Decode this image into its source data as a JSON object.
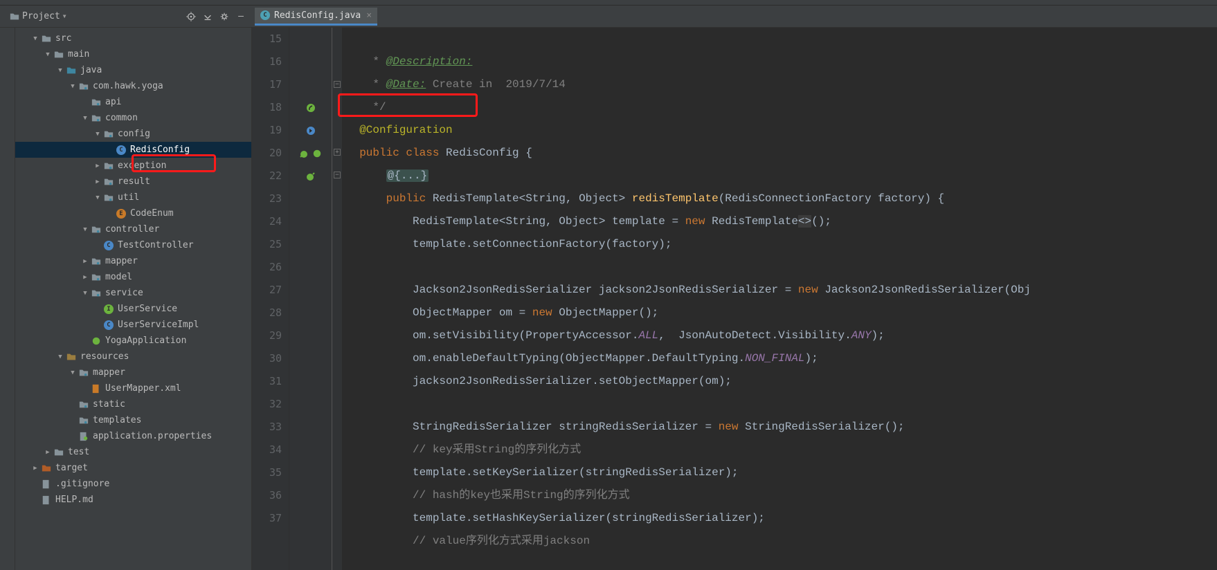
{
  "toolbar": {
    "project_label": "Project",
    "tab_name": "RedisConfig.java"
  },
  "tree": [
    {
      "depth": 0,
      "arrow": "open",
      "icon": "folder",
      "label": "src",
      "selectable": true
    },
    {
      "depth": 1,
      "arrow": "open",
      "icon": "folder",
      "label": "main",
      "selectable": true
    },
    {
      "depth": 2,
      "arrow": "open",
      "icon": "folder-src",
      "label": "java",
      "selectable": true
    },
    {
      "depth": 3,
      "arrow": "open",
      "icon": "package",
      "label": "com.hawk.yoga",
      "selectable": true
    },
    {
      "depth": 4,
      "arrow": "none",
      "icon": "package",
      "label": "api",
      "selectable": true
    },
    {
      "depth": 4,
      "arrow": "open",
      "icon": "package",
      "label": "common",
      "selectable": true
    },
    {
      "depth": 5,
      "arrow": "open",
      "icon": "package",
      "label": "config",
      "selectable": true
    },
    {
      "depth": 6,
      "arrow": "none",
      "icon": "class",
      "label": "RedisConfig",
      "selectable": true,
      "selected": true
    },
    {
      "depth": 5,
      "arrow": "closed",
      "icon": "package",
      "label": "exception",
      "selectable": true
    },
    {
      "depth": 5,
      "arrow": "closed",
      "icon": "package",
      "label": "result",
      "selectable": true
    },
    {
      "depth": 5,
      "arrow": "open",
      "icon": "package",
      "label": "util",
      "selectable": true
    },
    {
      "depth": 6,
      "arrow": "none",
      "icon": "enum",
      "label": "CodeEnum",
      "selectable": true
    },
    {
      "depth": 4,
      "arrow": "open",
      "icon": "package",
      "label": "controller",
      "selectable": true
    },
    {
      "depth": 5,
      "arrow": "none",
      "icon": "class",
      "label": "TestController",
      "selectable": true
    },
    {
      "depth": 4,
      "arrow": "closed",
      "icon": "package",
      "label": "mapper",
      "selectable": true
    },
    {
      "depth": 4,
      "arrow": "closed",
      "icon": "package",
      "label": "model",
      "selectable": true
    },
    {
      "depth": 4,
      "arrow": "open",
      "icon": "package",
      "label": "service",
      "selectable": true
    },
    {
      "depth": 5,
      "arrow": "none",
      "icon": "interface",
      "label": "UserService",
      "selectable": true
    },
    {
      "depth": 5,
      "arrow": "none",
      "icon": "class",
      "label": "UserServiceImpl",
      "selectable": true
    },
    {
      "depth": 4,
      "arrow": "none",
      "icon": "spring",
      "label": "YogaApplication",
      "selectable": true
    },
    {
      "depth": 2,
      "arrow": "open",
      "icon": "folder-res",
      "label": "resources",
      "selectable": true
    },
    {
      "depth": 3,
      "arrow": "open",
      "icon": "package",
      "label": "mapper",
      "selectable": true
    },
    {
      "depth": 4,
      "arrow": "none",
      "icon": "xml",
      "label": "UserMapper.xml",
      "selectable": true
    },
    {
      "depth": 3,
      "arrow": "none",
      "icon": "package",
      "label": "static",
      "selectable": true
    },
    {
      "depth": 3,
      "arrow": "none",
      "icon": "package",
      "label": "templates",
      "selectable": true
    },
    {
      "depth": 3,
      "arrow": "none",
      "icon": "spring-file",
      "label": "application.properties",
      "selectable": true
    },
    {
      "depth": 1,
      "arrow": "closed",
      "icon": "folder",
      "label": "test",
      "selectable": true
    },
    {
      "depth": 0,
      "arrow": "closed",
      "icon": "folder-exclude",
      "label": "target",
      "selectable": true
    },
    {
      "depth": 0,
      "arrow": "none",
      "icon": "file",
      "label": ".gitignore",
      "selectable": true
    },
    {
      "depth": 0,
      "arrow": "none",
      "icon": "file",
      "label": "HELP.md",
      "selectable": true
    }
  ],
  "editor": {
    "line_numbers": [
      "15",
      "16",
      "17",
      "18",
      "19",
      "20",
      "22",
      "23",
      "24",
      "25",
      "26",
      "27",
      "28",
      "29",
      "30",
      "31",
      "32",
      "33",
      "34",
      "35",
      "36",
      "37"
    ],
    "lines": {
      "l15": {
        "prefix": " * ",
        "tag": "@Description:"
      },
      "l16": {
        "prefix": " * ",
        "tag": "@Date:",
        "rest": " Create in  2019/7/14"
      },
      "l17": {
        "text": " */"
      },
      "l18": {
        "ann": "@Configuration"
      },
      "l19": {
        "kw1": "public ",
        "kw2": "class ",
        "name": "RedisConfig ",
        "brace": "{"
      },
      "l20": {
        "folded": "@{...}"
      },
      "l22": {
        "kw": "public ",
        "type": "RedisTemplate<String, Object> ",
        "method": "redisTemplate",
        "params": "(RedisConnectionFactory factory) {"
      },
      "l23": {
        "pre": "RedisTemplate<String, Object> template = ",
        "new": "new ",
        "ctor": "RedisTemplate",
        "diamond": "<>",
        "tail": "();"
      },
      "l24": {
        "text": "template.setConnectionFactory(factory);"
      },
      "l26": {
        "pre": "Jackson2JsonRedisSerializer jackson2JsonRedisSerializer = ",
        "new": "new ",
        "ctor": "Jackson2JsonRedisSerializer(Obj"
      },
      "l27": {
        "pre": "ObjectMapper om = ",
        "new": "new ",
        "ctor": "ObjectMapper();"
      },
      "l28": {
        "pre": "om.setVisibility(PropertyAccessor.",
        "f1": "ALL",
        "mid": ",  JsonAutoDetect",
        "dot": ".Visibility.",
        "f2": "ANY",
        "tail": ");"
      },
      "l29": {
        "pre": "om.enableDefaultTyping(ObjectMapper.DefaultTyping.",
        "f1": "NON_FINAL",
        "tail": ");"
      },
      "l30": {
        "text": "jackson2JsonRedisSerializer.setObjectMapper(om);"
      },
      "l32": {
        "pre": "StringRedisSerializer stringRedisSerializer = ",
        "new": "new ",
        "ctor": "StringRedisSerializer();"
      },
      "l33": {
        "text": "// key采用String的序列化方式"
      },
      "l34": {
        "text": "template.setKeySerializer(stringRedisSerializer);"
      },
      "l35": {
        "text": "// hash的key也采用String的序列化方式"
      },
      "l36": {
        "text": "template.setHashKeySerializer(stringRedisSerializer);"
      },
      "l37": {
        "text": "// value序列化方式采用jackson"
      }
    }
  }
}
